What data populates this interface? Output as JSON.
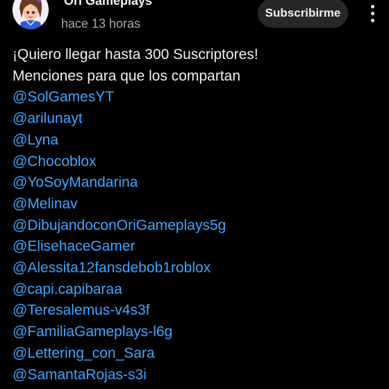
{
  "post": {
    "channel_name": "Ori Gameplays",
    "timestamp": "hace 13 horas",
    "subscribe_label": "Subscribirme",
    "more_icon": "more-vert-icon",
    "text_lines": [
      "¡Quiero llegar hasta 300 Suscriptores!",
      "Menciones para que los compartan"
    ],
    "mentions": [
      "@SolGamesYT",
      "@arilunayt",
      "@Lyna",
      "@Chocoblox",
      "@YoSoyMandarina",
      "@Melinav",
      "@DibujandoconOriGameplays5g",
      "@ElisehaceGamer",
      "@Alessita12fansdebob1roblox",
      "@capi.capibaraa",
      "@Teresalemus-v4s3f",
      "@FamiliaGameplays-l6g",
      "@Lettering_con_Sara",
      "@SamantaRojas-s3i"
    ]
  },
  "colors": {
    "background": "#000000",
    "text": "#f1f1f1",
    "secondary_text": "#aaaaaa",
    "link": "#3ea6ff",
    "button_bg": "#272727"
  }
}
